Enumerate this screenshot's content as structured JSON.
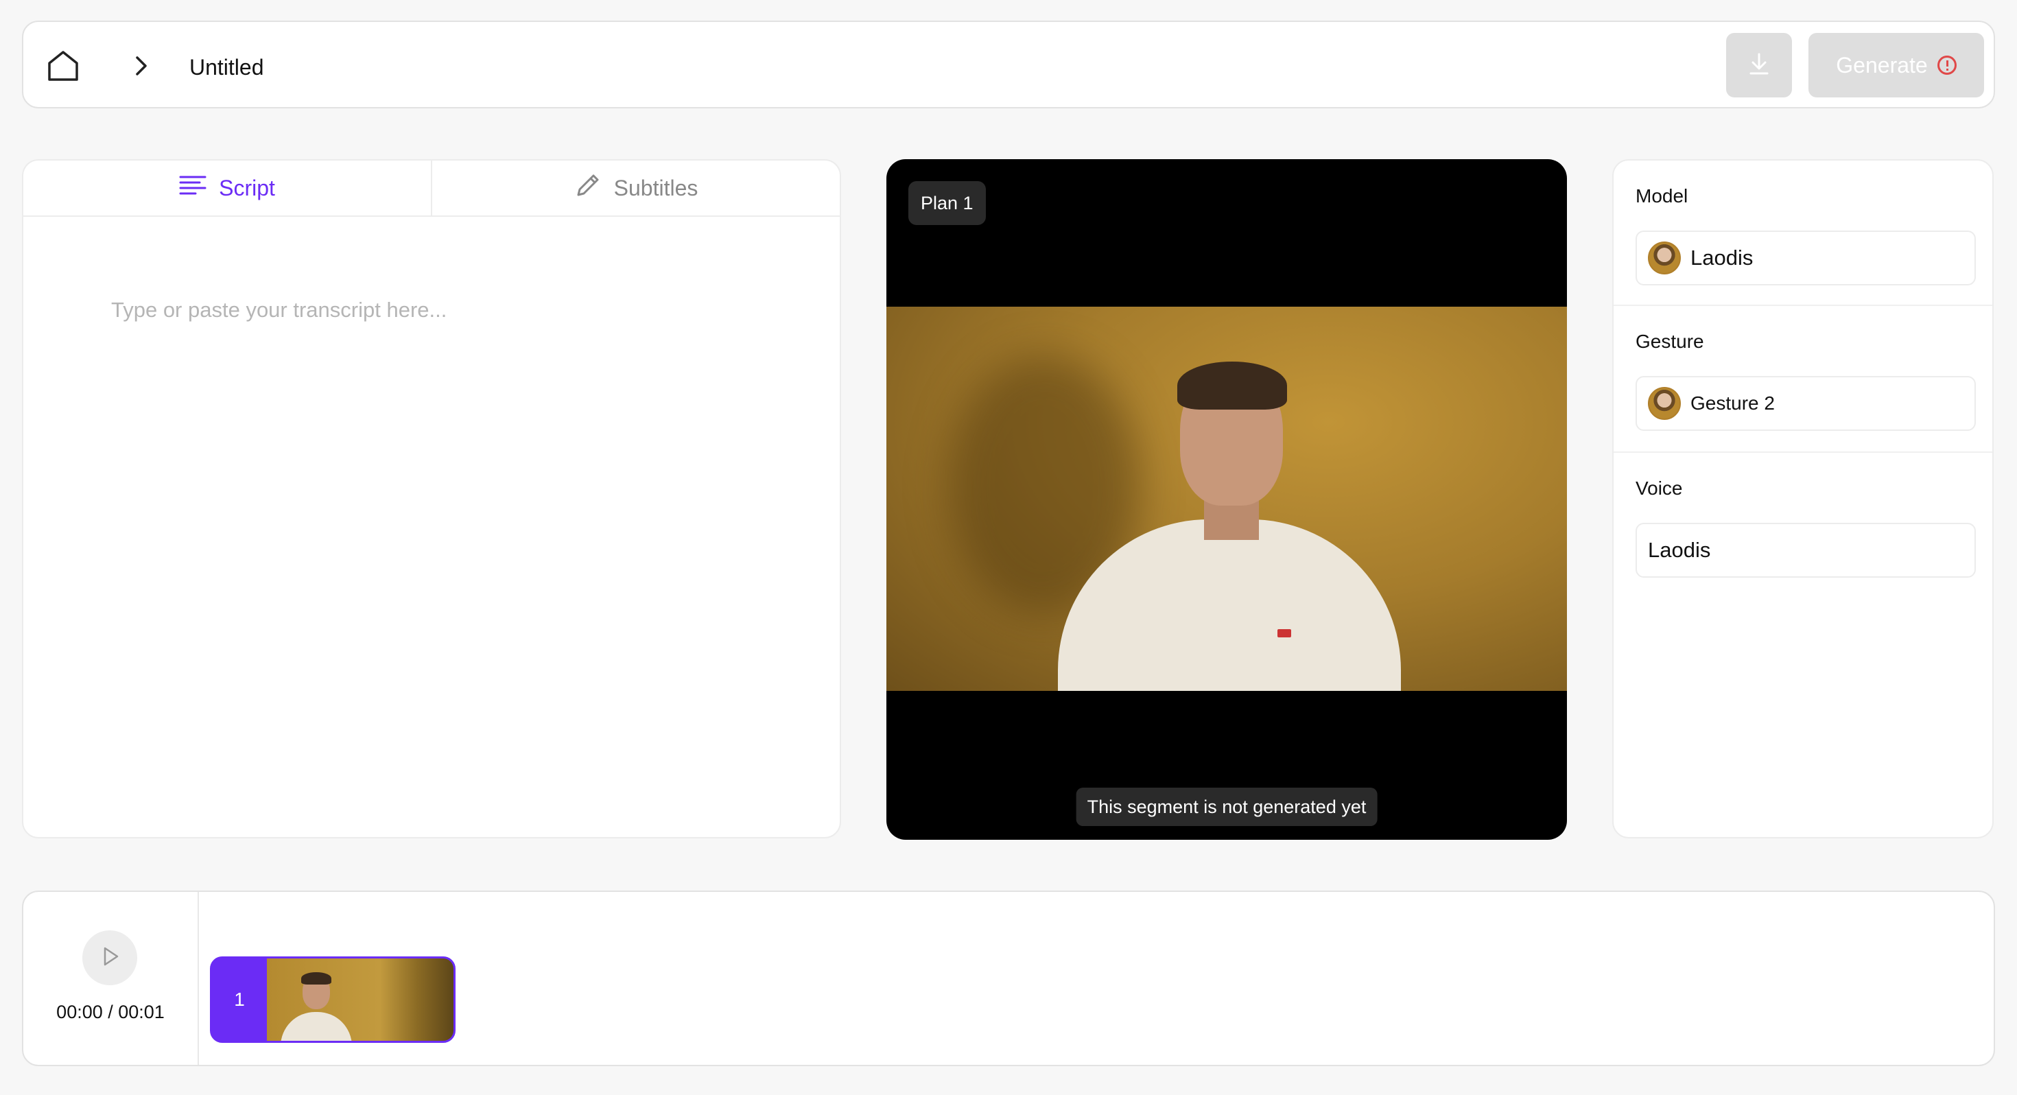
{
  "header": {
    "title": "Untitled",
    "generate_label": "Generate"
  },
  "script": {
    "tabs": [
      {
        "label": "Script",
        "active": true
      },
      {
        "label": "Subtitles",
        "active": false
      }
    ],
    "placeholder": "Type or paste your transcript here..."
  },
  "preview": {
    "plan_label": "Plan 1",
    "status_note": "This segment is not generated yet"
  },
  "settings": {
    "model": {
      "label": "Model",
      "value": "Laodis"
    },
    "gesture": {
      "label": "Gesture",
      "value": "Gesture 2"
    },
    "voice": {
      "label": "Voice",
      "value": "Laodis"
    }
  },
  "timeline": {
    "time": "00:00 / 00:01",
    "segments": [
      {
        "number": "1"
      }
    ]
  },
  "colors": {
    "accent": "#6b2cf5",
    "alert": "#e04848",
    "disabled_button": "#dedede"
  },
  "icons": [
    "home-icon",
    "chevron-right-icon",
    "download-icon",
    "alert-icon",
    "lines-icon",
    "pen-icon",
    "play-icon"
  ]
}
